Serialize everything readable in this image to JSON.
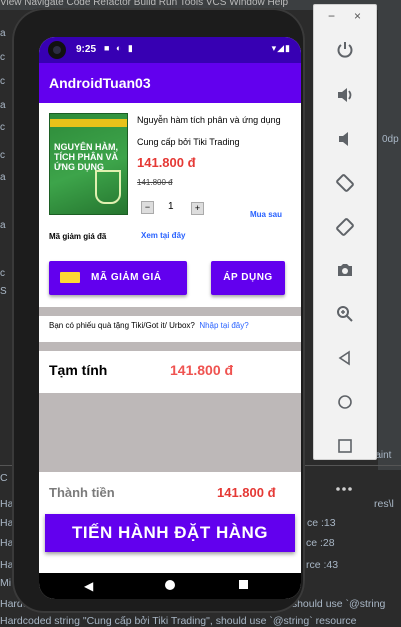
{
  "ide": {
    "top_text": "View   Navigate   Code   Refactor   Build   Run   Tools   VCS   Window   Help",
    "left_items": [
      "a",
      "c",
      "c",
      "a",
      "c",
      "c",
      "a",
      "a",
      "c",
      "S"
    ],
    "right_items": [
      "0dp",
      "raint"
    ],
    "bottom_lines": [
      {
        "left": "C",
        "right": ""
      },
      {
        "left": "Ha",
        "right": "res\\l"
      },
      {
        "left": "Ha",
        "right": "ce :13"
      },
      {
        "left": "Ha",
        "right": "ce :28"
      },
      {
        "left": "Ha",
        "right": "rce :43"
      },
      {
        "left": "Mi",
        "right": ""
      },
      {
        "left": "Hardc",
        "right": ", should use `@string"
      },
      {
        "left": "Hardcoded string \"Cung cấp bởi Tiki Trading\", should use `@string` resource",
        "right": ""
      }
    ]
  },
  "device": {
    "time": "9:25",
    "app_title": "AndroidTuan03"
  },
  "product": {
    "cover_title": "NGUYÊN HÀM, TÍCH PHÂN VÀ ỨNG DỤNG",
    "name": "Nguyễn hàm tích phân và ứng dụng",
    "vendor": "Cung cấp bởi Tiki Trading",
    "price": "141.800 đ",
    "old_price": "141.800 đ",
    "quantity": "1",
    "minus": "−",
    "plus": "+",
    "buy_later": "Mua sau",
    "coupon_label": "Mã giảm giá đã",
    "coupon_view": "Xem tại đây"
  },
  "coupon": {
    "button_label": "MÃ GIẢM GIÁ",
    "apply_label": "ÁP DỤNG"
  },
  "gift": {
    "text": "Bạn có phiếu quà tặng Tiki/Got it/ Urbox?",
    "link": "Nhập tại đây?"
  },
  "summary": {
    "subtotal_label": "Tạm tính",
    "subtotal_value": "141.800 đ",
    "total_label": "Thành tiền",
    "total_value": "141.800 đ",
    "checkout_label": "TIẾN HÀNH ĐẶT HÀNG"
  },
  "emulator": {
    "minimize": "−",
    "close": "×",
    "tools": [
      "power-icon",
      "volume-up-icon",
      "volume-down-icon",
      "rotate-left-icon",
      "rotate-right-icon",
      "camera-icon",
      "zoom-icon",
      "back-icon",
      "home-icon",
      "overview-icon",
      "more-icon"
    ]
  }
}
